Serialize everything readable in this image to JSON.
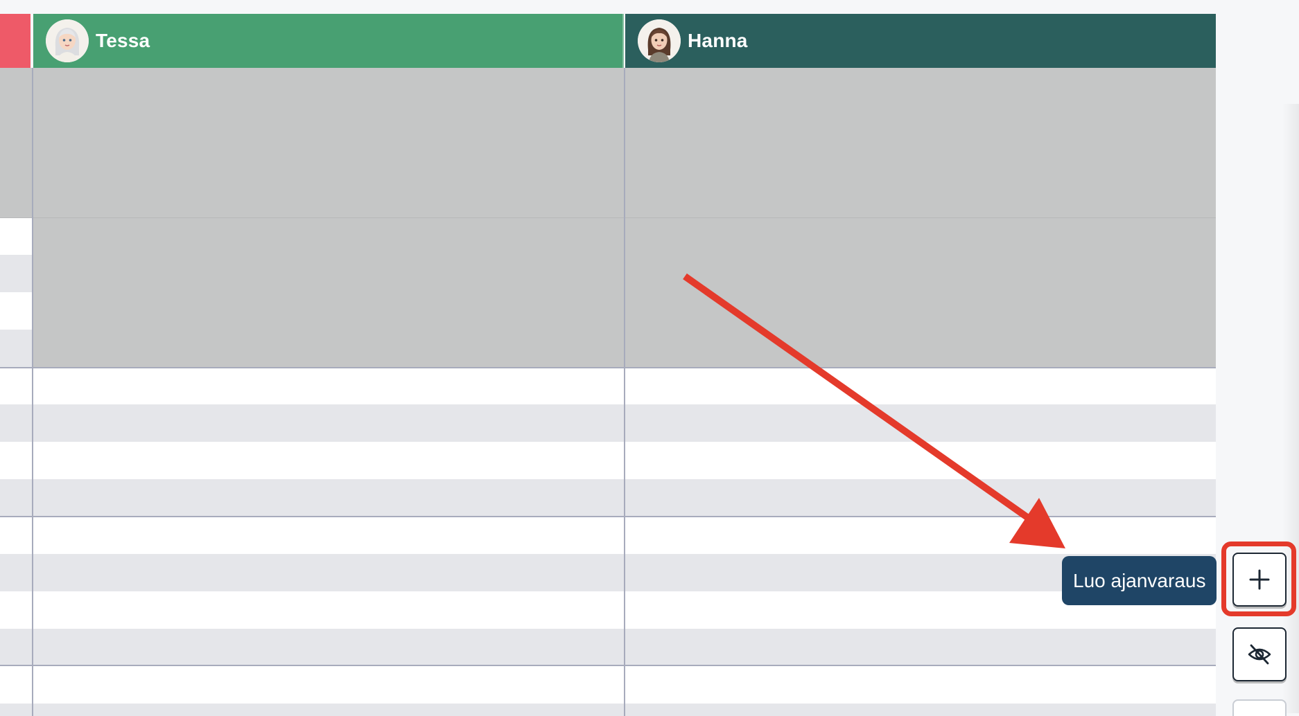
{
  "columns": [
    {
      "name": "Tessa",
      "header_color": "#48a072"
    },
    {
      "name": "Hanna",
      "header_color": "#2b5f5d"
    }
  ],
  "icons": {
    "add": "plus-icon",
    "visibility": "eye-off-icon"
  },
  "tooltip": {
    "text": "Luo ajanvaraus"
  },
  "colors": {
    "left_header": "#ee5a68",
    "blocked_time": "#c5c6c6",
    "alt_row": "#e5e6ea",
    "tooltip_bg": "#1f4566",
    "annotation": "#e43a2b"
  }
}
